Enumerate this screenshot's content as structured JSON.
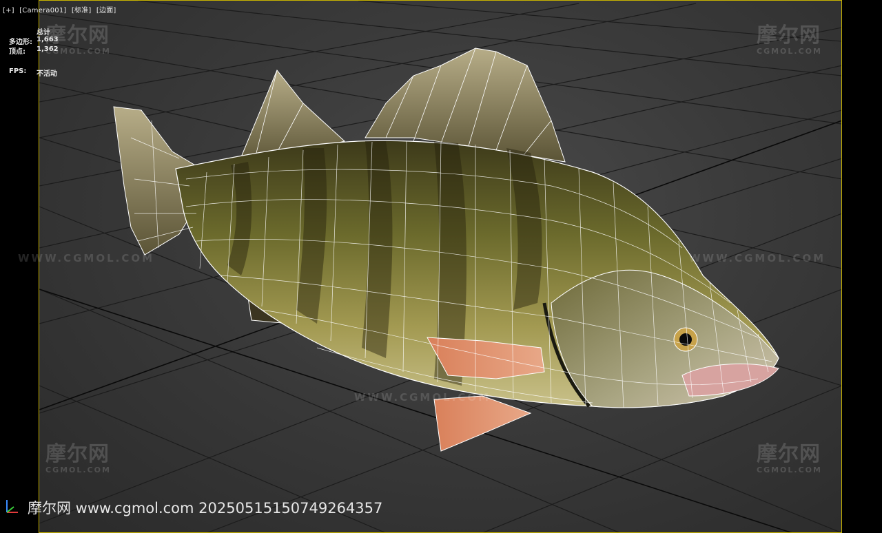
{
  "viewport": {
    "labels": [
      "[+]",
      "[Camera001]",
      "[标准]",
      "[边面]"
    ]
  },
  "stats": {
    "title": "总计",
    "polygons_label": "多边形:",
    "polygons_value": "1,663",
    "vertices_label": "顶点:",
    "vertices_value": "1,362",
    "fps_label": "FPS:",
    "fps_value": "不活动"
  },
  "watermark": {
    "brand_cn": "摩尔网",
    "brand_en": "CGMOL.COM",
    "url_line": "WWW.CGMOL.COM",
    "footer": "摩尔网 www.cgmol.com 20250515150749264357"
  },
  "colors": {
    "viewport_border": "#c9b400",
    "grid_line": "#1a1a1a",
    "wireframe": "#ffffff"
  }
}
